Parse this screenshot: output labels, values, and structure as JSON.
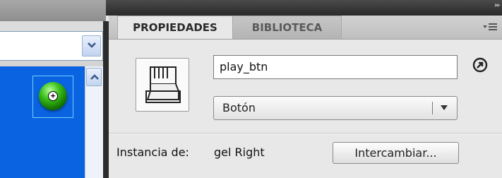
{
  "panel": {
    "tabs": [
      {
        "label": "PROPIEDADES",
        "active": true
      },
      {
        "label": "BIBLIOTECA",
        "active": false
      }
    ]
  },
  "properties": {
    "instance_name": "play_btn",
    "symbol_type": "Botón",
    "instance_of_label": "Instancia de:",
    "instance_of_value": "gel Right",
    "swap_button": "Intercambiar..."
  },
  "left_pane": {
    "combo_value": ""
  },
  "icons": {
    "symbol": "button-symbol-icon",
    "edit": "edit-in-place-icon",
    "menu": "panel-menu-icon",
    "library_item": "green-gel-button-icon"
  },
  "colors": {
    "stage_blue": "#0a63e0",
    "panel_bg": "#e8e8e8",
    "active_tab_text": "#2a2a2a",
    "inactive_tab_text": "#5a5a5a"
  }
}
